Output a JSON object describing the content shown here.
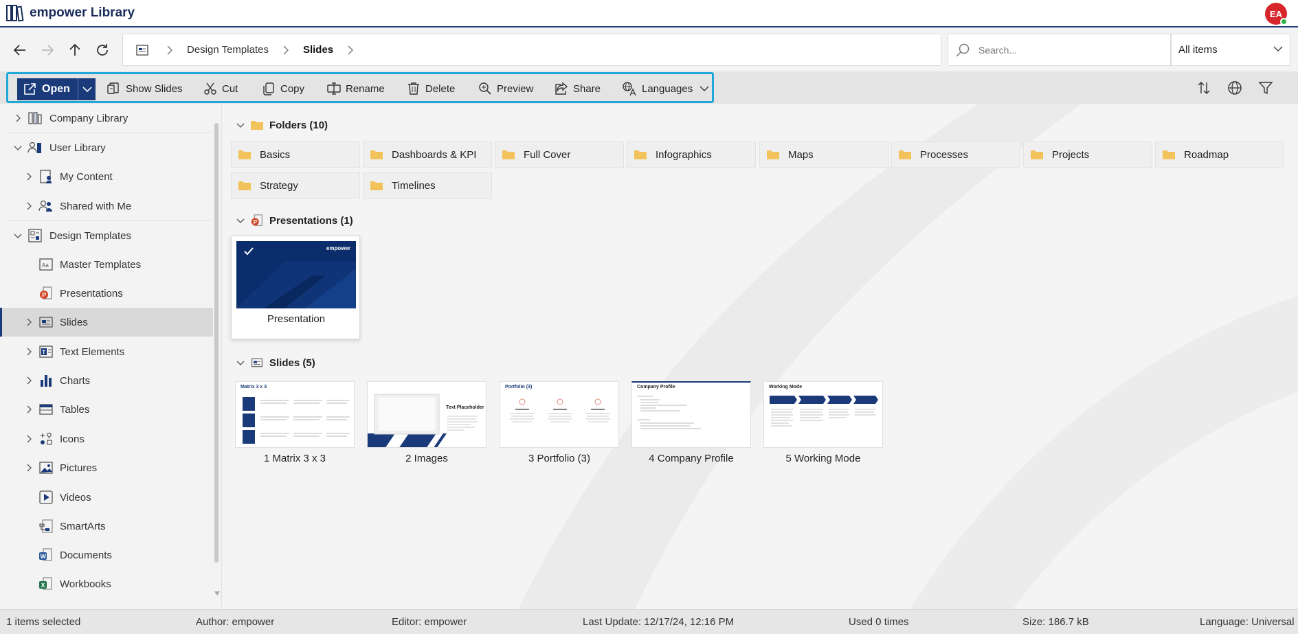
{
  "app": {
    "title": "empower Library",
    "avatar_initials": "EA"
  },
  "breadcrumb": {
    "items": [
      "Design Templates",
      "Slides"
    ]
  },
  "search": {
    "placeholder": "Search...",
    "scope": "All items"
  },
  "toolbar": {
    "open": "Open",
    "show_slides": "Show Slides",
    "cut": "Cut",
    "copy": "Copy",
    "rename": "Rename",
    "delete": "Delete",
    "preview": "Preview",
    "share": "Share",
    "languages": "Languages"
  },
  "sidebar": {
    "items": [
      {
        "label": "Company Library",
        "icon": "company-library-icon"
      },
      {
        "label": "User Library",
        "icon": "user-library-icon"
      },
      {
        "label": "My Content",
        "icon": "my-content-icon"
      },
      {
        "label": "Shared with Me",
        "icon": "shared-users-icon"
      },
      {
        "label": "Design Templates",
        "icon": "design-templates-icon"
      },
      {
        "label": "Master Templates",
        "icon": "master-template-icon"
      },
      {
        "label": "Presentations",
        "icon": "powerpoint-icon"
      },
      {
        "label": "Slides",
        "icon": "slide-icon"
      },
      {
        "label": "Text Elements",
        "icon": "text-element-icon"
      },
      {
        "label": "Charts",
        "icon": "chart-icon"
      },
      {
        "label": "Tables",
        "icon": "table-icon"
      },
      {
        "label": "Icons",
        "icon": "icons-icon"
      },
      {
        "label": "Pictures",
        "icon": "picture-icon"
      },
      {
        "label": "Videos",
        "icon": "video-icon"
      },
      {
        "label": "SmartArts",
        "icon": "smartart-icon"
      },
      {
        "label": "Documents",
        "icon": "word-icon"
      },
      {
        "label": "Workbooks",
        "icon": "excel-icon"
      }
    ]
  },
  "sections": {
    "folders": {
      "title": "Folders",
      "count": "(10)"
    },
    "presentations": {
      "title": "Presentations",
      "count": "(1)"
    },
    "slides": {
      "title": "Slides",
      "count": "(5)"
    }
  },
  "folders": [
    "Basics",
    "Dashboards & KPI",
    "Full Cover",
    "Infographics",
    "Maps",
    "Processes",
    "Projects",
    "Roadmap",
    "Strategy",
    "Timelines"
  ],
  "presentation": {
    "label": "Presentation",
    "thumb_brand": "empower"
  },
  "slides": [
    {
      "label": "1 Matrix 3 x 3",
      "thumb_title": "Matrix 3 x 3"
    },
    {
      "label": "2 Images",
      "thumb_title": "Text Placeholder"
    },
    {
      "label": "3 Portfolio (3)",
      "thumb_title": "Portfolio (3)"
    },
    {
      "label": "4 Company Profile",
      "thumb_title": "Company Profile"
    },
    {
      "label": "5 Working Mode",
      "thumb_title": "Working Mode"
    }
  ],
  "status": {
    "selected": "1 items selected",
    "author": "Author: empower",
    "editor": "Editor: empower",
    "last_update": "Last Update: 12/17/24, 12:16 PM",
    "used": "Used 0 times",
    "size": "Size: 186.7 kB",
    "language": "Language: Universal"
  },
  "colors": {
    "brand": "#1a3a7a",
    "highlight": "#20a8d8",
    "folder": "#f2c35b"
  }
}
